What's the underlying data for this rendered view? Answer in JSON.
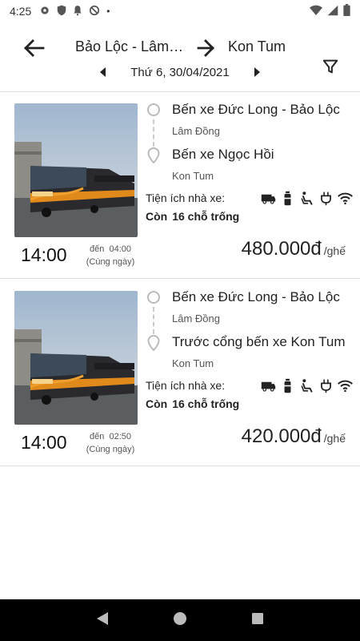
{
  "status_bar": {
    "time": "4:25",
    "dot": "•"
  },
  "header": {
    "from": "Bảo Lộc - Lâm Đồng",
    "to": "Kon Tum",
    "date": "Thứ 6, 30/04/2021"
  },
  "trips": [
    {
      "depart_time": "14:00",
      "arrive_prefix": "đến",
      "arrive_time": "04:00",
      "arrive_note": "(Cùng ngày)",
      "origin_name": "Bến xe Đức Long - Bảo Lộc",
      "origin_province": "Lâm Đồng",
      "dest_name": "Bến xe Ngọc Hồi",
      "dest_province": "Kon Tum",
      "amenities_label": "Tiện ích nhà xe:",
      "seats_label": "Còn",
      "seats_value": "16 chỗ trống",
      "price": "480.000đ",
      "price_unit": "/ghế"
    },
    {
      "depart_time": "14:00",
      "arrive_prefix": "đến",
      "arrive_time": "02:50",
      "arrive_note": "(Cùng ngày)",
      "origin_name": "Bến xe Đức Long - Bảo Lộc",
      "origin_province": "Lâm Đồng",
      "dest_name": "Trước cổng bến xe Kon Tum",
      "dest_province": "Kon Tum",
      "amenities_label": "Tiện ích nhà xe:",
      "seats_label": "Còn",
      "seats_value": "16 chỗ trống",
      "price": "420.000đ",
      "price_unit": "/ghế"
    }
  ],
  "amenity_icons": [
    "bus-icon",
    "water-bottle-icon",
    "seat-recline-icon",
    "power-plug-icon",
    "wifi-icon"
  ],
  "colors": {
    "accent": "#222222",
    "nav_bar": "#000000"
  }
}
